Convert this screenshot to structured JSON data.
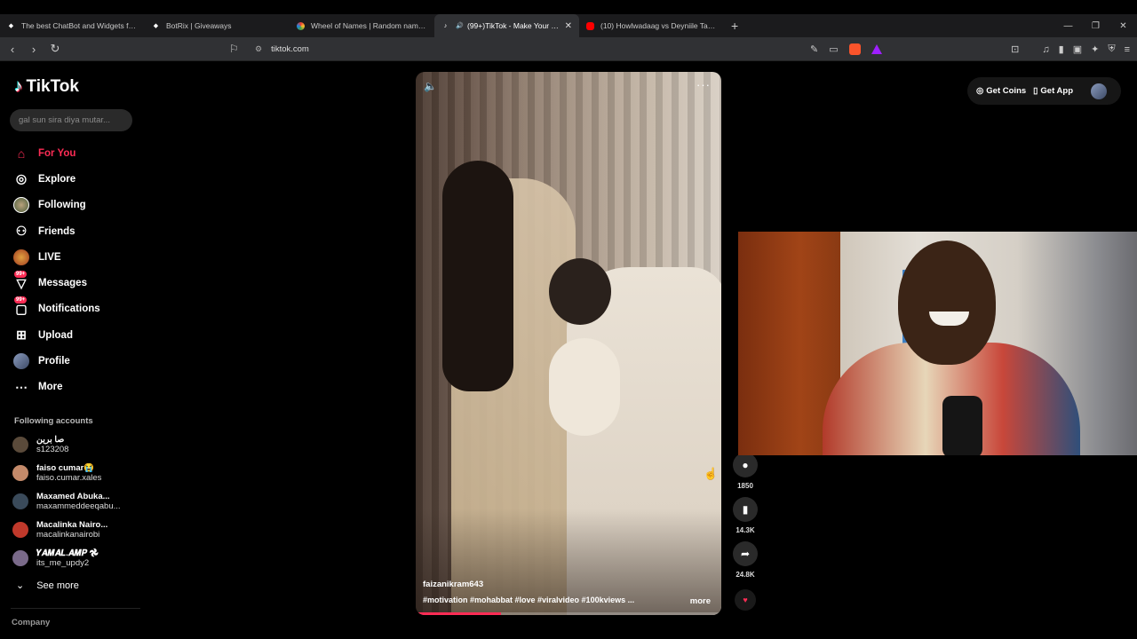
{
  "browser": {
    "tabs": [
      {
        "title": "The best ChatBot and Widgets for Ki",
        "icon": "botrix-icon",
        "active": false,
        "favicon_color": "#ffffff"
      },
      {
        "title": "BotRix | Giveaways",
        "icon": "botrix-icon",
        "active": false,
        "favicon_color": "#ffffff"
      },
      {
        "title": "Wheel of Names | Random name pic",
        "icon": "wheel-icon",
        "active": false,
        "favicon_color": "#4caf50"
      },
      {
        "title": "(99+)TikTok - Make Your Day",
        "icon": "tiktok-icon",
        "active": true,
        "favicon_color": "#ffffff"
      },
      {
        "title": "(10) Howlwadaag vs Deyniile Tartank",
        "icon": "youtube-icon",
        "active": false,
        "favicon_color": "#ff0000"
      }
    ],
    "new_tab": "+",
    "url": "tiktok.com"
  },
  "tiktok": {
    "logo_text": "TikTok",
    "search_placeholder": "gal sun sira diya mutar...",
    "nav": [
      {
        "label": "For You",
        "icon": "home-icon",
        "active": true
      },
      {
        "label": "Explore",
        "icon": "compass-icon",
        "active": false
      },
      {
        "label": "Following",
        "icon": "following-avatar-icon",
        "active": false
      },
      {
        "label": "Friends",
        "icon": "friends-icon",
        "active": false
      },
      {
        "label": "LIVE",
        "icon": "live-avatar-icon",
        "active": false
      },
      {
        "label": "Messages",
        "icon": "messages-icon",
        "active": false,
        "badge": "99+"
      },
      {
        "label": "Notifications",
        "icon": "notifications-icon",
        "active": false,
        "badge": "99+"
      },
      {
        "label": "Upload",
        "icon": "upload-icon",
        "active": false
      },
      {
        "label": "Profile",
        "icon": "profile-avatar-icon",
        "active": false
      },
      {
        "label": "More",
        "icon": "more-icon",
        "active": false
      }
    ],
    "following_title": "Following accounts",
    "accounts": [
      {
        "name": "صا برين",
        "handle": "s123208",
        "color": "#5a4a3a"
      },
      {
        "name": "faiso cumar😭",
        "handle": "faiso.cumar.xales",
        "color": "#c48a6a"
      },
      {
        "name": "Maxamed Abuka...",
        "handle": "maxammeddeeqabu...",
        "color": "#3a4a5a"
      },
      {
        "name": "Macalinka Nairo...",
        "handle": "macalinkanairobi",
        "color": "#c0392b"
      },
      {
        "name": "𝒀𝑨𝑴𝑨𝑳.𝑨𝑴𝑷 𖣘",
        "handle": "its_me_updy2",
        "color": "#7a6a8a"
      }
    ],
    "see_more": "See more",
    "company": "Company",
    "video": {
      "author": "faizanikram643",
      "caption": "#motivation #mohabbat #love #viralvideo #100kviews ...",
      "more_label": "more",
      "progress": 0.28
    },
    "actions": [
      {
        "icon": "comment-icon",
        "count": "1850"
      },
      {
        "icon": "bookmark-icon",
        "count": "14.3K"
      },
      {
        "icon": "share-icon",
        "count": "24.8K"
      }
    ],
    "top_right": {
      "get_coins": "Get Coins",
      "get_app": "Get App"
    }
  }
}
